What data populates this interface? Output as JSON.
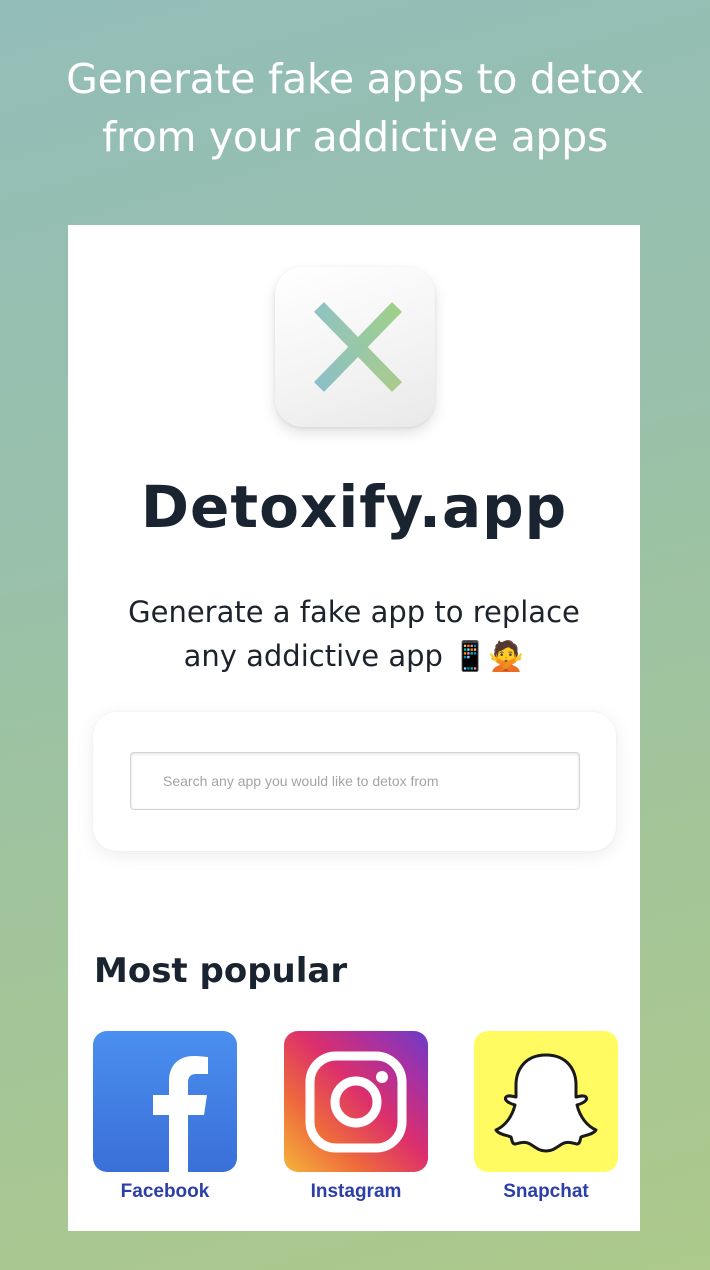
{
  "promo": {
    "headline_line1": "Generate fake apps to detox",
    "headline_line2": "from your addictive apps"
  },
  "app": {
    "icon": "x-mark-icon",
    "title": "Detoxify.app",
    "tagline_line1": "Generate a fake app to replace",
    "tagline_line2": "any addictive app 📱🙅"
  },
  "search": {
    "value": "",
    "placeholder": "Search any app you would like to detox from"
  },
  "popular": {
    "heading": "Most popular",
    "apps": [
      {
        "label": "Facebook",
        "icon": "facebook-icon"
      },
      {
        "label": "Instagram",
        "icon": "instagram-icon"
      },
      {
        "label": "Snapchat",
        "icon": "snapchat-icon"
      }
    ]
  },
  "colors": {
    "background_gradient": [
      "#93bdb8",
      "#adc98b"
    ],
    "title_text": "#1a2330",
    "app_label": "#2c3fa8",
    "facebook_blue": "#3a6fd8",
    "snapchat_yellow": "#fffb60"
  }
}
